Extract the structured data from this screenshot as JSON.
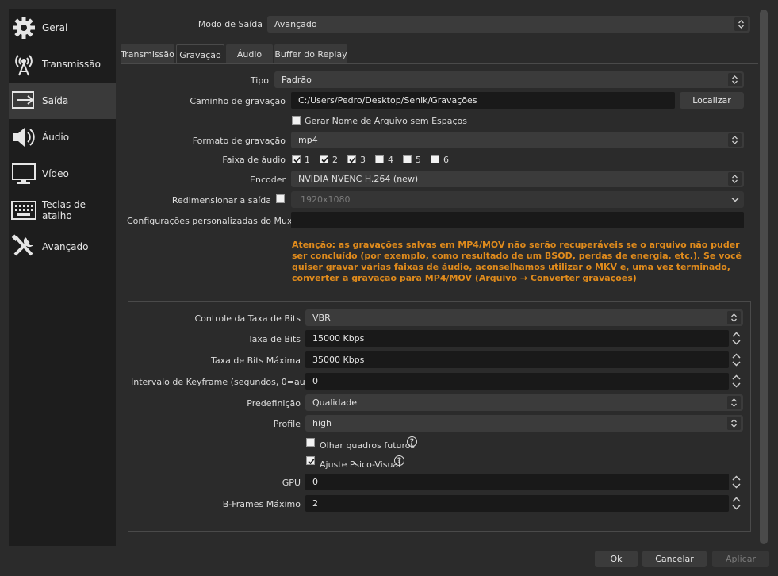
{
  "sidebar": {
    "items": [
      {
        "label": "Geral",
        "icon": "gear-icon"
      },
      {
        "label": "Transmissão",
        "icon": "broadcast-icon"
      },
      {
        "label": "Saída",
        "icon": "output-icon"
      },
      {
        "label": "Áudio",
        "icon": "speaker-icon"
      },
      {
        "label": "Vídeo",
        "icon": "monitor-icon"
      },
      {
        "label": "Teclas de atalho",
        "icon": "keyboard-icon"
      },
      {
        "label": "Avançado",
        "icon": "tools-icon"
      }
    ],
    "active_index": 2
  },
  "output_mode": {
    "label": "Modo de Saída",
    "value": "Avançado"
  },
  "tabs": [
    {
      "label": "Transmissão"
    },
    {
      "label": "Gravação"
    },
    {
      "label": "Áudio"
    },
    {
      "label": "Buffer do Replay"
    }
  ],
  "active_tab": "Gravação",
  "recording": {
    "type": {
      "label": "Tipo",
      "value": "Padrão"
    },
    "path": {
      "label": "Caminho de gravação",
      "value": "C:/Users/Pedro/Desktop/Senik/Gravações",
      "browse_label": "Localizar"
    },
    "no_spaces": {
      "label": "Gerar Nome de Arquivo sem Espaços",
      "checked": false
    },
    "format": {
      "label": "Formato de gravação",
      "value": "mp4"
    },
    "audio_tracks": {
      "label": "Faixa de áudio",
      "tracks": [
        {
          "label": "1",
          "checked": true
        },
        {
          "label": "2",
          "checked": true
        },
        {
          "label": "3",
          "checked": true
        },
        {
          "label": "4",
          "checked": false
        },
        {
          "label": "5",
          "checked": false
        },
        {
          "label": "6",
          "checked": false
        }
      ]
    },
    "encoder": {
      "label": "Encoder",
      "value": "NVIDIA NVENC H.264 (new)"
    },
    "rescale": {
      "label": "Redimensionar a saída",
      "checked": false,
      "value": "1920x1080"
    },
    "muxer": {
      "label": "Configurações personalizadas do Muxer",
      "value": ""
    },
    "warning": "Atenção: as gravações salvas em MP4/MOV não serão recuperáveis se o arquivo não puder ser concluído (por exemplo, como resultado de um BSOD, perdas de energia, etc.). Se você quiser gravar várias faixas de áudio, aconselhamos utilizar o MKV e, uma vez terminado, converter a gravação para MP4/MOV (Arquivo → Converter gravações)"
  },
  "encoder_settings": {
    "rate_control": {
      "label": "Controle da Taxa de Bits",
      "value": "VBR"
    },
    "bitrate": {
      "label": "Taxa de Bits",
      "value": "15000 Kbps"
    },
    "max_bitrate": {
      "label": "Taxa de Bits Máxima",
      "value": "35000 Kbps"
    },
    "keyframe": {
      "label": "Intervalo de Keyframe (segundos, 0=auto)",
      "value": "0"
    },
    "preset": {
      "label": "Predefinição",
      "value": "Qualidade"
    },
    "profile": {
      "label": "Profile",
      "value": "high"
    },
    "lookahead": {
      "label": "Olhar quadros futuros",
      "checked": false
    },
    "psycho_visual": {
      "label": "Ajuste Psico-Visual",
      "checked": true
    },
    "gpu": {
      "label": "GPU",
      "value": "0"
    },
    "bframes": {
      "label": "B-Frames Máximo",
      "value": "2"
    }
  },
  "footer": {
    "ok": "Ok",
    "cancel": "Cancelar",
    "apply": "Aplicar"
  },
  "colors": {
    "warning": "#e08b1c",
    "sidebar_bg": "#1d1d1d",
    "window_bg": "#2b2b2b"
  }
}
